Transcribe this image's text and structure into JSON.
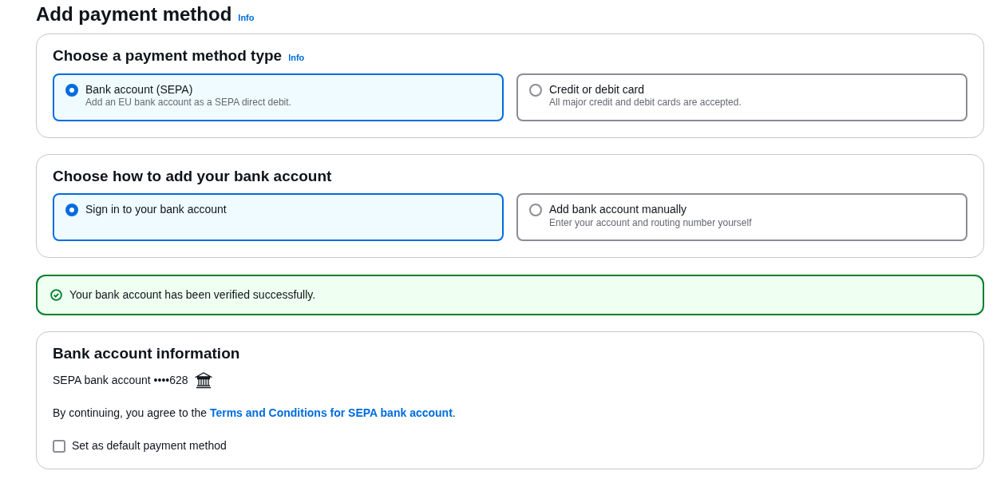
{
  "page": {
    "title": "Add payment method",
    "info": "Info"
  },
  "sections": [
    {
      "title": "Choose a payment method type",
      "info": "Info",
      "options": [
        {
          "label": "Bank account (SEPA)",
          "description": "Add an EU bank account as a SEPA direct debit.",
          "selected": true
        },
        {
          "label": "Credit or debit card",
          "description": "All major credit and debit cards are accepted.",
          "selected": false
        }
      ]
    },
    {
      "title": "Choose how to add your bank account",
      "options": [
        {
          "label": "Sign in to your bank account",
          "selected": true
        },
        {
          "label": "Add bank account manually",
          "description": "Enter your account and routing number yourself",
          "selected": false
        }
      ]
    }
  ],
  "alert": {
    "kind": "success",
    "message": "Your bank account has been verified successfully."
  },
  "bank_info": {
    "title": "Bank account information",
    "account": "SEPA bank account ••••628",
    "agreement": {
      "before": "By continuing, you agree to the ",
      "link": "Terms and Conditions for SEPA bank account",
      "after": "."
    },
    "default_checkbox": {
      "label": "Set as default payment method",
      "checked": false
    }
  }
}
